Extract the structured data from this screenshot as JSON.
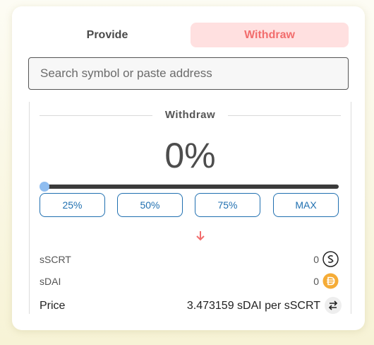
{
  "tabs": {
    "provide": "Provide",
    "withdraw": "Withdraw",
    "active": "withdraw"
  },
  "search": {
    "placeholder": "Search symbol or paste address",
    "value": ""
  },
  "withdraw_section": {
    "title": "Withdraw",
    "percent_display": "0%",
    "slider_value_percent": 0,
    "buttons": [
      "25%",
      "50%",
      "75%",
      "MAX"
    ]
  },
  "tokens": [
    {
      "symbol": "sSCRT",
      "amount": "0",
      "icon": "sscrt-coin-icon"
    },
    {
      "symbol": "sDAI",
      "amount": "0",
      "icon": "sdai-coin-icon"
    }
  ],
  "price": {
    "label": "Price",
    "value": "3.473159 sDAI per sSCRT",
    "swap_icon": "swap-arrows-icon"
  },
  "colors": {
    "withdraw_accent": "#f26d6d",
    "withdraw_tab_bg": "#ffe0e0",
    "button_blue": "#1f6fb0",
    "slider_thumb": "#8fbdf0",
    "sdai_coin": "#f5ac37"
  }
}
